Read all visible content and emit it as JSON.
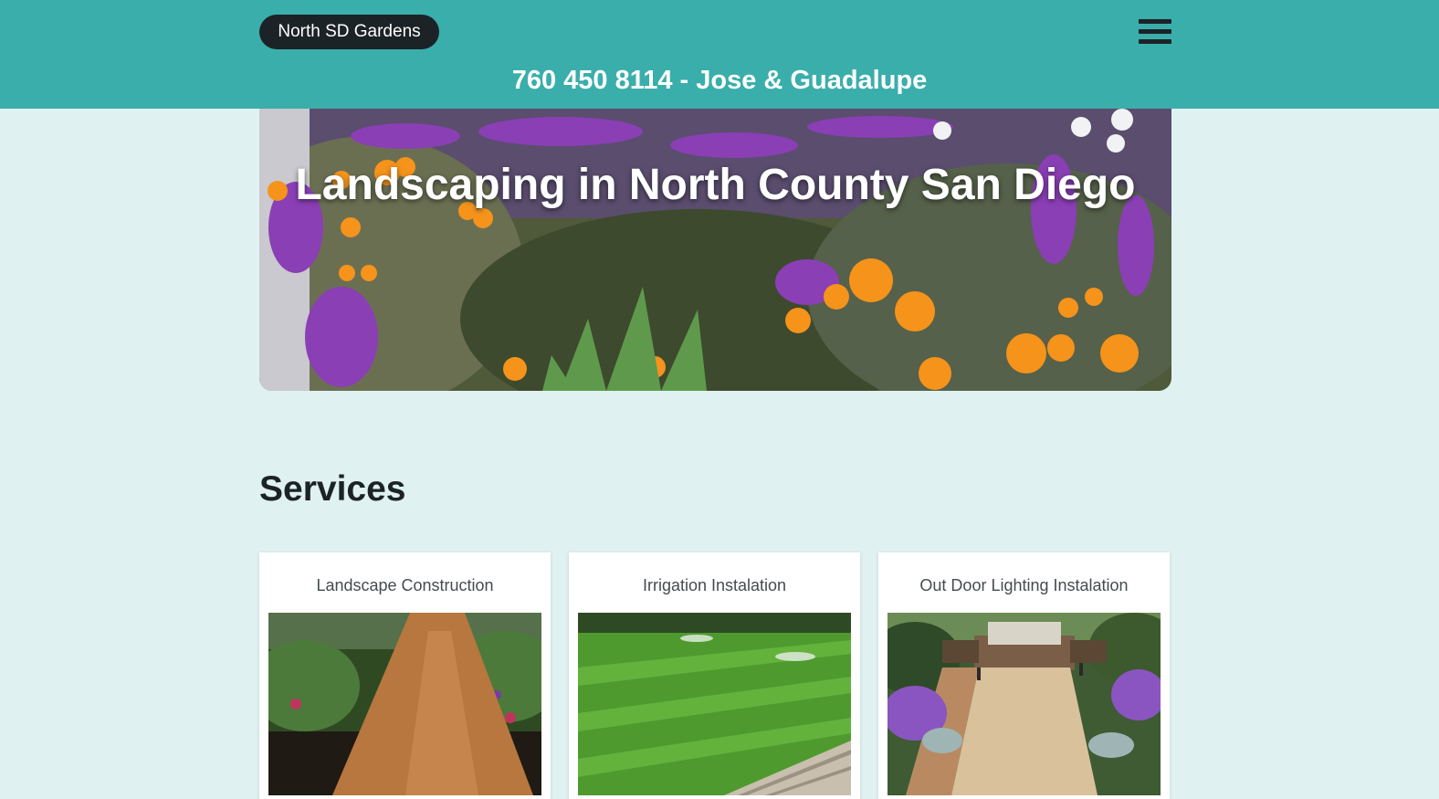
{
  "header": {
    "brand": "North SD Gardens",
    "phone_line": "760 450 8114 - Jose & Guadalupe",
    "menu_icon": "hamburger-menu-icon",
    "background_color": "#3aaeab"
  },
  "hero": {
    "title": "Landscaping in North County San Diego",
    "image": "flower-garden-photo"
  },
  "services": {
    "heading": "Services",
    "cards": [
      {
        "title": "Landscape Construction",
        "image": "stone-walkway-photo"
      },
      {
        "title": "Irrigation Instalation",
        "image": "lawn-sprinkler-photo"
      },
      {
        "title": "Out Door Lighting Instalation",
        "image": "patio-lighting-photo"
      }
    ]
  },
  "colors": {
    "page_background": "#dff1f0",
    "dark": "#1c2327",
    "card_background": "#ffffff"
  }
}
